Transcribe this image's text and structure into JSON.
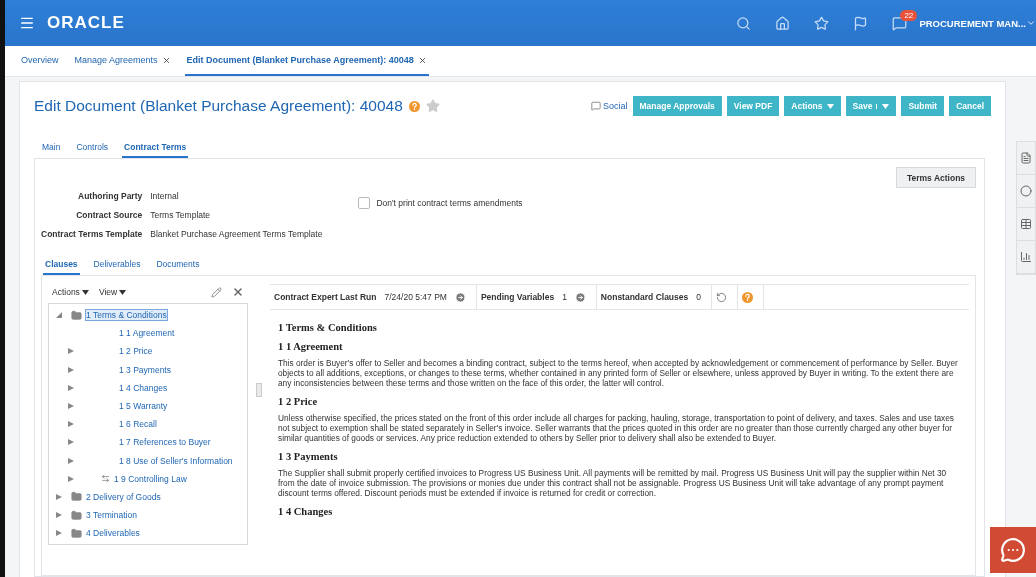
{
  "header": {
    "logo": "ORACLE",
    "notifications": "22",
    "user": "PROCUREMENT MAN..."
  },
  "page_tabs": [
    {
      "label": "Overview",
      "selected": false,
      "closable": false
    },
    {
      "label": "Manage Agreements",
      "selected": false,
      "closable": true
    },
    {
      "label": "Edit Document (Blanket Purchase Agreement): 40048",
      "selected": true,
      "closable": true
    }
  ],
  "title": "Edit Document (Blanket Purchase Agreement): 40048",
  "favorite": false,
  "toolbar": {
    "social": "Social",
    "buttons": [
      {
        "label": "Manage Approvals",
        "kind": "plain"
      },
      {
        "label": "View PDF",
        "kind": "plain"
      },
      {
        "label": "Actions",
        "kind": "menu"
      },
      {
        "label": "Save",
        "kind": "split"
      },
      {
        "label": "Submit",
        "kind": "plain"
      },
      {
        "label": "Cancel",
        "kind": "plain"
      }
    ]
  },
  "section_tabs": [
    {
      "label": "Main",
      "selected": false
    },
    {
      "label": "Controls",
      "selected": false
    },
    {
      "label": "Contract Terms",
      "selected": true
    }
  ],
  "terms_actions": "Terms Actions",
  "fields": [
    {
      "label": "Authoring Party",
      "value": "Internal"
    },
    {
      "label": "Contract Source",
      "value": "Terms Template"
    },
    {
      "label": "Contract Terms Template",
      "value": "Blanket Purchase Agreement Terms Template"
    }
  ],
  "dont_print": {
    "label": "Don't print contract terms amendments",
    "checked": false
  },
  "sub_tabs": [
    {
      "label": "Clauses",
      "selected": true
    },
    {
      "label": "Deliverables",
      "selected": false
    },
    {
      "label": "Documents",
      "selected": false
    }
  ],
  "tree_toolbar": {
    "actions": "Actions",
    "view": "View"
  },
  "tree": [
    {
      "label": "1 Terms & Conditions",
      "kind": "section",
      "expandable": true,
      "expanded": true,
      "selected": true,
      "children": [
        {
          "label": "1 1 Agreement",
          "kind": "clause",
          "expandable": false,
          "expanded": false,
          "selected": false
        },
        {
          "label": "1 2 Price",
          "kind": "clause",
          "expandable": true,
          "expanded": false,
          "selected": false
        },
        {
          "label": "1 3 Payments",
          "kind": "clause",
          "expandable": true,
          "expanded": false,
          "selected": false
        },
        {
          "label": "1 4 Changes",
          "kind": "clause",
          "expandable": true,
          "expanded": false,
          "selected": false
        },
        {
          "label": "1 5 Warranty",
          "kind": "clause",
          "expandable": true,
          "expanded": false,
          "selected": false
        },
        {
          "label": "1 6 Recall",
          "kind": "clause",
          "expandable": true,
          "expanded": false,
          "selected": false
        },
        {
          "label": "1 7 References to Buyer",
          "kind": "clause",
          "expandable": true,
          "expanded": false,
          "selected": false
        },
        {
          "label": "1 8 Use of Seller's Information",
          "kind": "clause",
          "expandable": true,
          "expanded": false,
          "selected": false
        },
        {
          "label": "1 9 Controlling Law",
          "kind": "alternate",
          "expandable": true,
          "expanded": false,
          "selected": false
        }
      ]
    },
    {
      "label": "2 Delivery of Goods",
      "kind": "section",
      "expandable": true,
      "expanded": false,
      "selected": false
    },
    {
      "label": "3 Termination",
      "kind": "section",
      "expandable": true,
      "expanded": false,
      "selected": false
    },
    {
      "label": "4 Deliverables",
      "kind": "section",
      "expandable": true,
      "expanded": false,
      "selected": false
    }
  ],
  "status": [
    {
      "label": "Contract Expert Last Run",
      "value": "7/24/20 5:47 PM"
    },
    {
      "label": "Pending Variables",
      "value": "1"
    },
    {
      "label": "Nonstandard Clauses",
      "value": "0"
    }
  ],
  "document": [
    {
      "kind": "heading",
      "text": "1 Terms & Conditions"
    },
    {
      "kind": "heading",
      "text": "1 1 Agreement"
    },
    {
      "kind": "paragraph",
      "text": "This order is Buyer's offer to Seller and becomes a binding contract, subject to the terms hereof, when accepted by acknowledgement or commencement of performance by Seller. Buyer objects to all additions, exceptions, or changes to these terms, whether contained in any printed form of Seller or elsewhere, unless approved by Buyer in writing. To the extent there are any inconsistencies between these terms and those written on the face of this order, the latter will control."
    },
    {
      "kind": "heading",
      "text": "1 2 Price"
    },
    {
      "kind": "paragraph",
      "text": "Unless otherwise specified, the prices stated on the front of this order include all charges for packing, hauling, storage, transportation to point of delivery, and taxes. Sales and use taxes not subject to exemption shall be stated separately in Seller's invoice. Seller warrants that the prices quoted in this order are no greater than those currently charged any other buyer for similar quantities of goods or services. Any price reduction extended to others by Seller prior to delivery shall also be extended to Buyer."
    },
    {
      "kind": "heading",
      "text": "1 3 Payments"
    },
    {
      "kind": "paragraph",
      "text": "The Supplier shall submit properly certified invoices to Progress US Business Unit. All payments will be remitted by mail. Progress US Business Unit will pay the supplier within Net 30 from the date of invoice submission. The provisions or monies due under this contract shall not be assignable. Progress US Business Unit will take advantage of any prompt payment discount terms offered. Discount periods must be extended if invoice is returned for credit or correction."
    },
    {
      "kind": "heading",
      "text": "1 4 Changes"
    }
  ]
}
